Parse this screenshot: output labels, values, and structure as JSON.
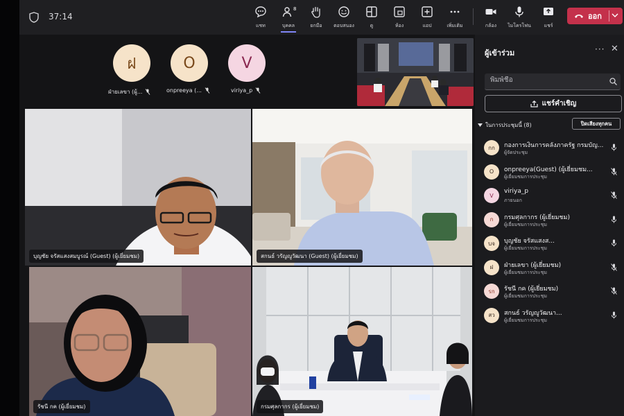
{
  "app": {
    "timer": "37:14",
    "toolbar": [
      {
        "key": "chat",
        "label": "แชท",
        "icon": "chat-icon"
      },
      {
        "key": "people",
        "label": "บุคคล",
        "icon": "people-icon",
        "badge": "8",
        "active": true
      },
      {
        "key": "raise",
        "label": "ยกมือ",
        "icon": "raise-hand-icon"
      },
      {
        "key": "react",
        "label": "ตอบสนอง",
        "icon": "react-icon"
      },
      {
        "key": "view",
        "label": "ดู",
        "icon": "view-icon"
      },
      {
        "key": "rooms",
        "label": "ห้อง",
        "icon": "rooms-icon"
      },
      {
        "key": "apps",
        "label": "แอป",
        "icon": "apps-icon"
      },
      {
        "key": "more",
        "label": "เพิ่มเติม",
        "icon": "more-icon"
      },
      {
        "key": "camera",
        "label": "กล้อง",
        "icon": "camera-icon"
      },
      {
        "key": "mic",
        "label": "ไมโครโฟน",
        "icon": "mic-icon"
      },
      {
        "key": "share",
        "label": "แชร์",
        "icon": "share-icon"
      }
    ],
    "leave_label": "ออก",
    "leave_color": "#c4314b"
  },
  "stage": {
    "avatars": [
      {
        "initial": "ฝ",
        "name": "ฝ่ายเลขา (ผู้...",
        "color": "#f6e3c9"
      },
      {
        "initial": "O",
        "name": "onpreeya (...",
        "color": "#f6e3c9"
      },
      {
        "initial": "V",
        "name": "viriya_p",
        "color": "#f5d6e2"
      }
    ],
    "tiles": [
      {
        "name": "บุญชัย จรัสแสงสมบูรณ์ (Guest) (ผู้เยี่ยมชม)"
      },
      {
        "name": "สกนธ์ วรัญญูวัฒนา (Guest) (ผู้เยี่ยมชม)"
      },
      {
        "name": "รัชนี กค (ผู้เยี่ยมชม)"
      },
      {
        "name": "กรมศุลกากร (ผู้เยี่ยมชม)"
      }
    ]
  },
  "panel": {
    "title": "ผู้เข้าร่วม",
    "search_placeholder": "พิมพ์ชื่อ",
    "share_invite": "แชร์คำเชิญ",
    "section_label": "ในการประชุมนี้ (8)",
    "mute_all": "ปิดเสียงทุกคน",
    "participants": [
      {
        "initials": "กก",
        "name": "กองการเงินการคลังภาครัฐ กรมบัญ...",
        "role": "ผู้จัดประชุม",
        "mic": "on",
        "color": "#f6e3c9"
      },
      {
        "initials": "O",
        "name": "onpreeya(Guest) (ผู้เยี่ยมชม...",
        "role": "ผู้เยี่ยมชมการประชุม",
        "mic": "off",
        "color": "#f6e3c9"
      },
      {
        "initials": "V",
        "name": "viriya_p",
        "role": "ภายนอก",
        "mic": "off",
        "color": "#f5d6e2"
      },
      {
        "initials": "ก",
        "name": "กรมศุลกากร (ผู้เยี่ยมชม)",
        "role": "ผู้เยี่ยมชมการประชุม",
        "mic": "on",
        "color": "#f6d9d5"
      },
      {
        "initials": "บจ",
        "name": "บุญชัย จรัสแสงส...",
        "role": "ผู้เยี่ยมชมการประชุม",
        "mic": "on",
        "color": "#f6e3c9"
      },
      {
        "initials": "ฝ",
        "name": "ฝ่ายเลขา (ผู้เยี่ยมชม)",
        "role": "ผู้เยี่ยมชมการประชุม",
        "mic": "off",
        "color": "#f6e3c9"
      },
      {
        "initials": "รก",
        "name": "รัชนี กค (ผู้เยี่ยมชม)",
        "role": "ผู้เยี่ยมชมการประชุม",
        "mic": "off",
        "color": "#f6d9d5"
      },
      {
        "initials": "สว",
        "name": "สกนธ์ วรัญญูวัฒนา...",
        "role": "ผู้เยี่ยมชมการประชุม",
        "mic": "on",
        "color": "#f6e3c9"
      }
    ]
  }
}
